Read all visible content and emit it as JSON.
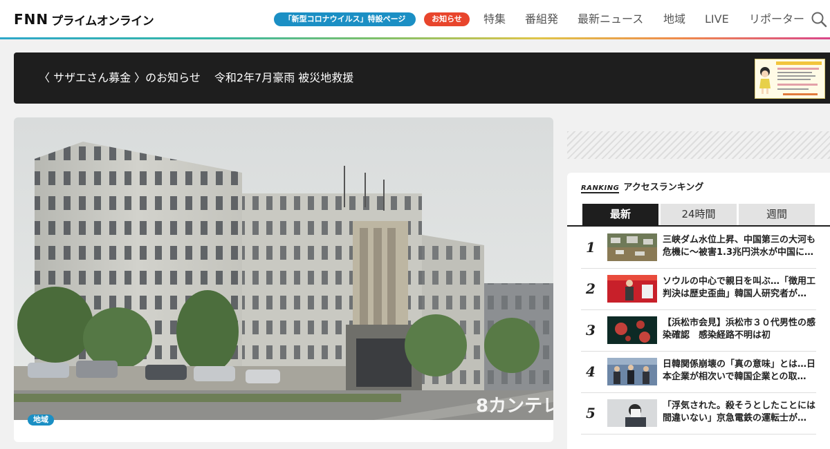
{
  "header": {
    "logo_mark": "FNN",
    "logo_sub": "プライムオンライン",
    "corona_pill": "「新型コロナウイルス」特設ページ",
    "news_pill": "お知らせ",
    "nav": [
      "特集",
      "番組発",
      "最新ニュース",
      "地域",
      "LIVE",
      "リポーター"
    ]
  },
  "banner": {
    "part1": "〈 サザエさん募金 〉のお知らせ",
    "part2": "令和2年7月豪雨 被災地救援"
  },
  "main": {
    "tag": "地域",
    "watermark": "8カンテレ"
  },
  "ranking": {
    "logo": "RANKING",
    "title": "アクセスランキング",
    "tabs": [
      "最新",
      "24時間",
      "週間"
    ],
    "items": [
      {
        "rank": "1",
        "title": "三峡ダム水位上昇、中国第三の大河も危機に～被害1.3兆円洪水が中国に…"
      },
      {
        "rank": "2",
        "title": "ソウルの中心で親日を叫ぶ…「徴用工判決は歴史歪曲」韓国人研究者が…"
      },
      {
        "rank": "3",
        "title": "【浜松市会見】浜松市３０代男性の感染確認　感染経路不明は初"
      },
      {
        "rank": "4",
        "title": "日韓関係崩壊の「真の意味」とは…日本企業が相次いで韓国企業との取…"
      },
      {
        "rank": "5",
        "title": "「浮気された。殺そうとしたことには間違いない」京急電鉄の運転士が…"
      }
    ]
  },
  "colors": {
    "accent_blue": "#1b8fc4",
    "accent_red": "#e8452c",
    "dark": "#1e1e1e"
  }
}
